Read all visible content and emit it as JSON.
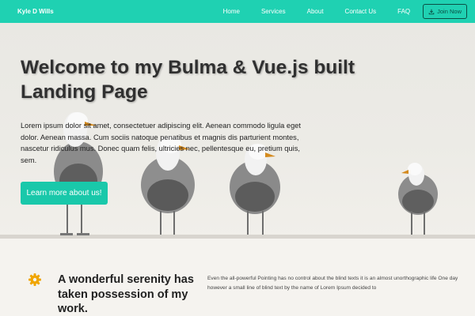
{
  "nav": {
    "brand": "Kyle D Wills",
    "links": [
      "Home",
      "Services",
      "About",
      "Contact Us",
      "FAQ"
    ],
    "join_label": "Join Now"
  },
  "hero": {
    "title": "Welcome to my Bulma & Vue.js built Landing Page",
    "text": "Lorem ipsum dolor sit amet, consectetuer adipiscing elit. Aenean commodo ligula eget dolor. Aenean massa. Cum sociis natoque penatibus et magnis dis parturient montes, nascetur ridiculus mus. Donec quam felis, ultricies nec, pellentesque eu, pretium quis, sem.",
    "cta_label": "Learn more about us!"
  },
  "feature": {
    "icon": "gear-icon",
    "title": "A wonderful serenity has taken possession of my work.",
    "text": "Even the all-powerful Pointing has no control about the blind texts it is an almost unorthographic life One day however a small line of blind text by the name of Lorem Ipsum decided to"
  },
  "colors": {
    "nav_bg": "#1fd1b2",
    "cta_bg": "#19c8aa",
    "icon": "#f0a500"
  }
}
